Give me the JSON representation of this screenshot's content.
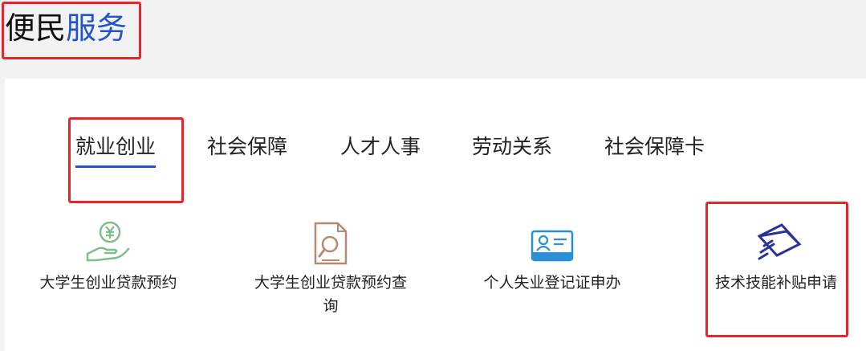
{
  "title": {
    "part1": "便民",
    "part2": "服务"
  },
  "tabs": [
    {
      "label": "就业创业",
      "active": true
    },
    {
      "label": "社会保障",
      "active": false
    },
    {
      "label": "人才人事",
      "active": false
    },
    {
      "label": "劳动关系",
      "active": false
    },
    {
      "label": "社会保障卡",
      "active": false
    }
  ],
  "services": [
    {
      "label": "大学生创业贷款预约",
      "icon": "hand-money-icon"
    },
    {
      "label": "大学生创业贷款预约查询",
      "icon": "document-search-icon"
    },
    {
      "label": "个人失业登记证申办",
      "icon": "id-card-icon"
    },
    {
      "label": "技术技能补贴申请",
      "icon": "subsidy-card-icon"
    }
  ],
  "colors": {
    "accent": "#1f55c9",
    "highlight": "#e8262a",
    "green": "#7dbf86",
    "brown": "#b58a6e",
    "cardBlue": "#2a8fd6",
    "navy": "#2a3496"
  }
}
